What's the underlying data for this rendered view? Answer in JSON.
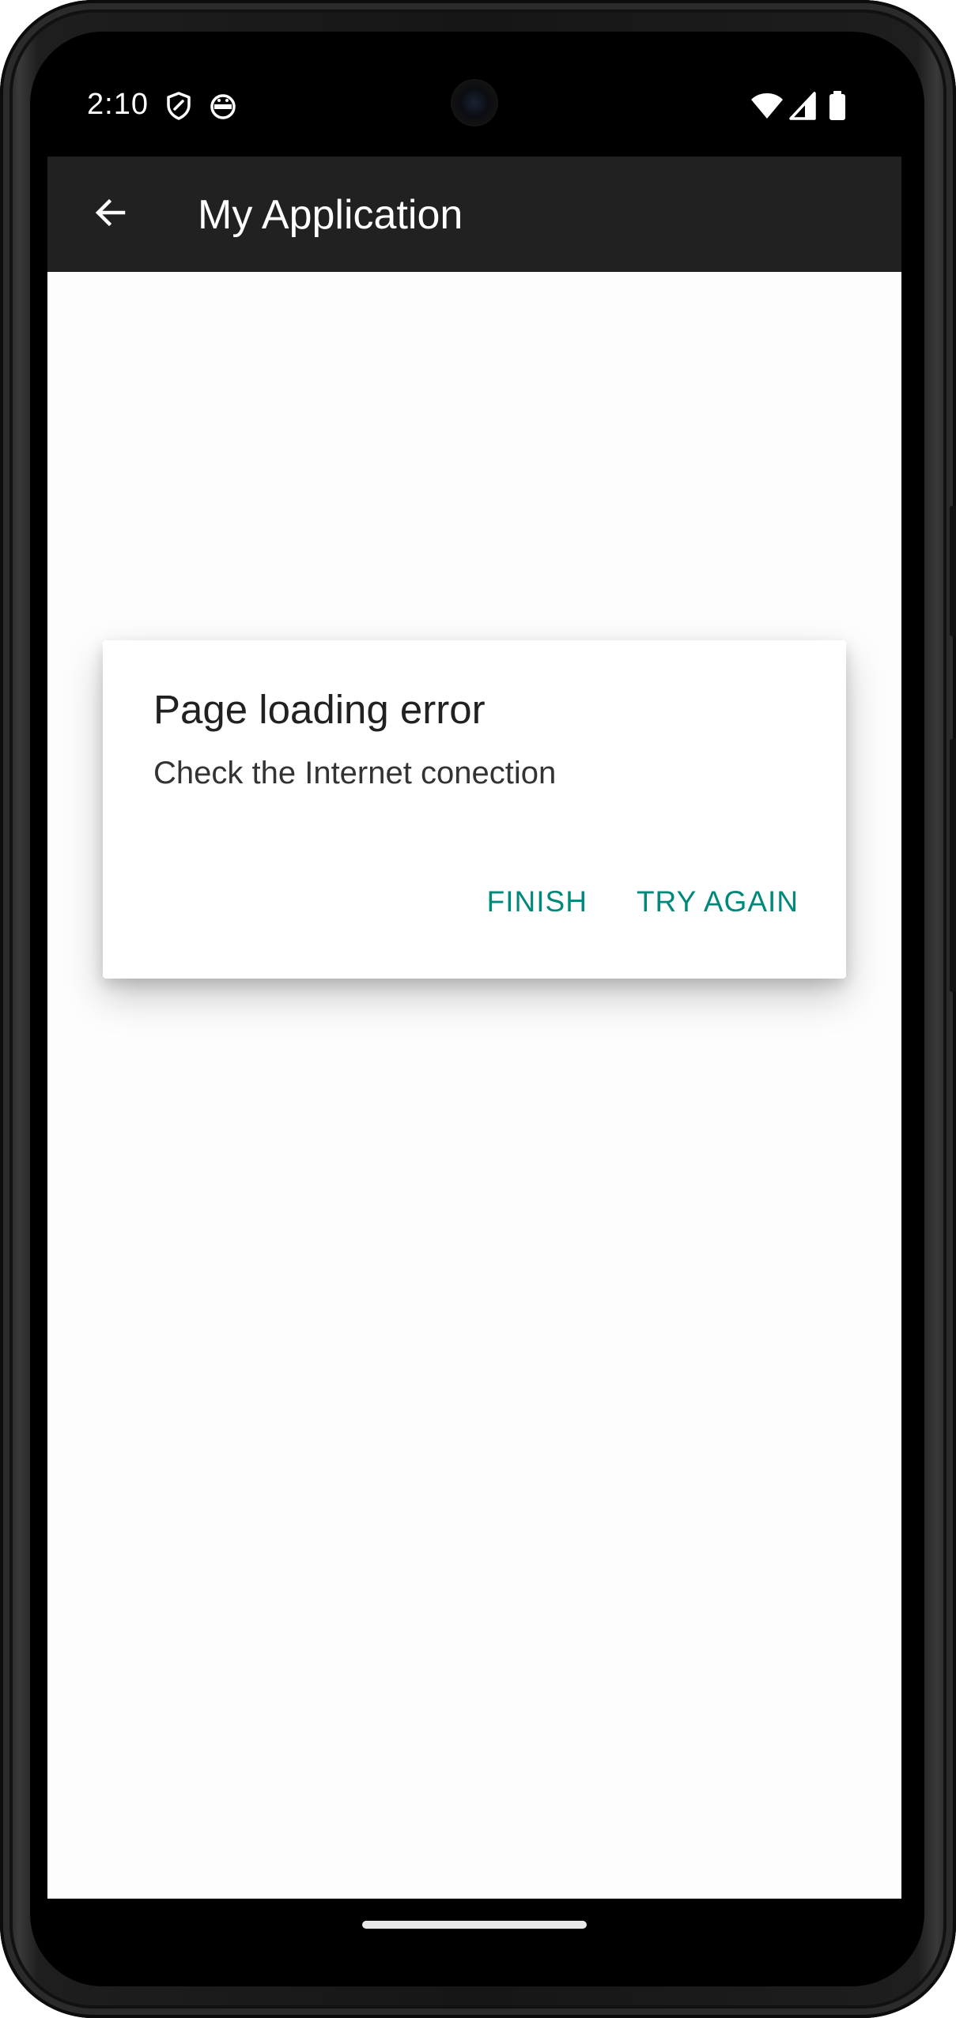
{
  "status_bar": {
    "time": "2:10",
    "left_icons": [
      "shield-icon",
      "android-debug-icon"
    ],
    "right_icons": [
      "wifi-icon",
      "cellular-signal-icon",
      "battery-icon"
    ]
  },
  "app_bar": {
    "title": "My Application",
    "back_icon": "arrow-back-icon",
    "background": "#212121"
  },
  "dialog": {
    "title": "Page loading error",
    "message": "Check the Internet conection",
    "buttons": {
      "finish": "FINISH",
      "try_again": "TRY AGAIN"
    },
    "accent": "#00897b"
  },
  "navigation": {
    "home_handle": "home-gesture-handle"
  }
}
